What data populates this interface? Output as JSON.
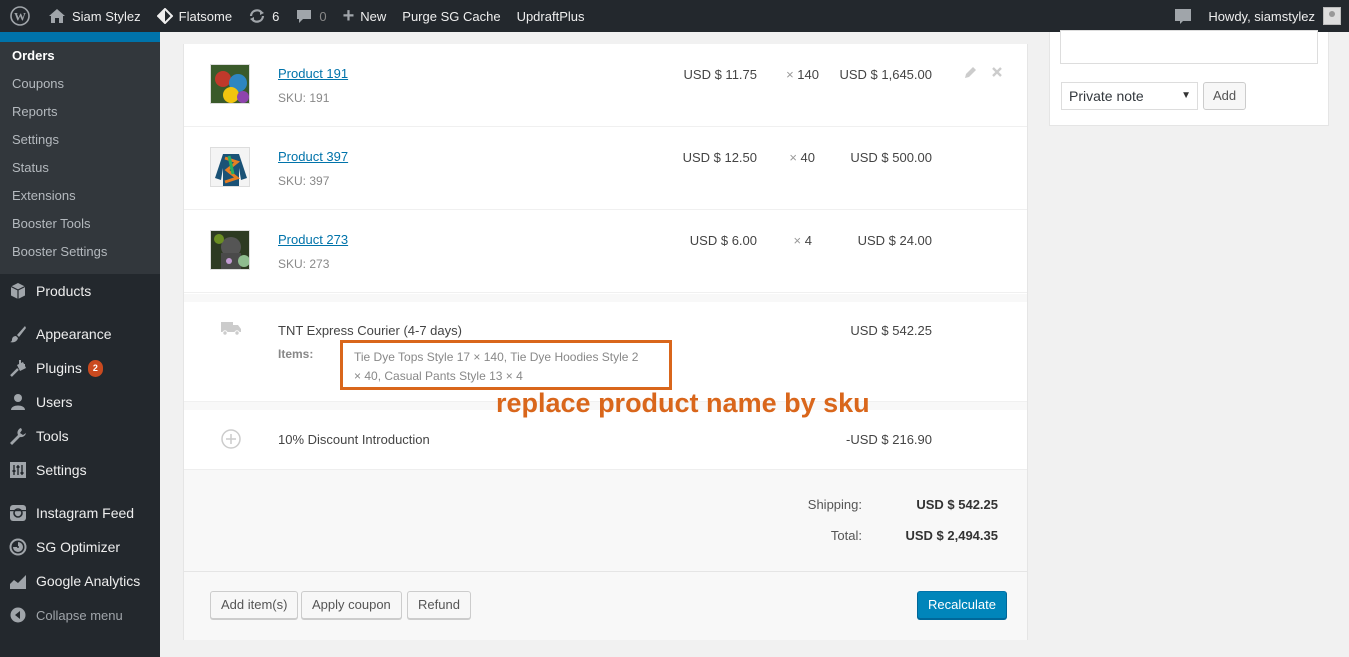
{
  "adminbar": {
    "site_name": "Siam Stylez",
    "theme": "Flatsome",
    "updates_count": "6",
    "comments_count": "0",
    "new_label": "New",
    "purge_label": "Purge SG Cache",
    "updraft_label": "UpdraftPlus",
    "howdy": "Howdy, siamstylez"
  },
  "sidebar": {
    "submenu": [
      "Orders",
      "Coupons",
      "Reports",
      "Settings",
      "Status",
      "Extensions",
      "Booster Tools",
      "Booster Settings"
    ],
    "menu": {
      "products": "Products",
      "appearance": "Appearance",
      "plugins": "Plugins",
      "plugins_badge": "2",
      "users": "Users",
      "tools": "Tools",
      "settings": "Settings",
      "instagram": "Instagram Feed",
      "sg_optimizer": "SG Optimizer",
      "google_analytics": "Google Analytics",
      "collapse": "Collapse menu"
    }
  },
  "order_items": [
    {
      "name": "Product 191",
      "sku_label": "SKU:",
      "sku": "191",
      "cost": "USD $ 11.75",
      "qty": "140",
      "total": "USD $ 1,645.00"
    },
    {
      "name": "Product 397",
      "sku_label": "SKU:",
      "sku": "397",
      "cost": "USD $ 12.50",
      "qty": "40",
      "total": "USD $ 500.00"
    },
    {
      "name": "Product 273",
      "sku_label": "SKU:",
      "sku": "273",
      "cost": "USD $ 6.00",
      "qty": "4",
      "total": "USD $ 24.00"
    }
  ],
  "times_symbol": "×",
  "shipping": {
    "method": "TNT Express Courier (4-7 days)",
    "items_label": "Items:",
    "items_line1": "Tie Dye Tops Style 17 × 140, Tie Dye Hoodies Style 2",
    "items_line2": "× 40, Casual Pants Style 13 × 4",
    "cost": "USD $ 542.25"
  },
  "discount": {
    "name": "10% Discount Introduction",
    "amount": "-USD $ 216.90"
  },
  "totals": {
    "shipping_label": "Shipping:",
    "shipping_value": "USD $ 542.25",
    "total_label": "Total:",
    "total_value": "USD $ 2,494.35"
  },
  "buttons": {
    "add_items": "Add item(s)",
    "apply_coupon": "Apply coupon",
    "refund": "Refund",
    "recalculate": "Recalculate"
  },
  "annotation": "replace product name by sku",
  "notes": {
    "type_selected": "Private note",
    "add": "Add"
  },
  "colors": {
    "admin_bar": "#23282d",
    "accent_blue": "#0073aa",
    "annotation_orange": "#d9661b",
    "button_primary": "#0085ba"
  }
}
